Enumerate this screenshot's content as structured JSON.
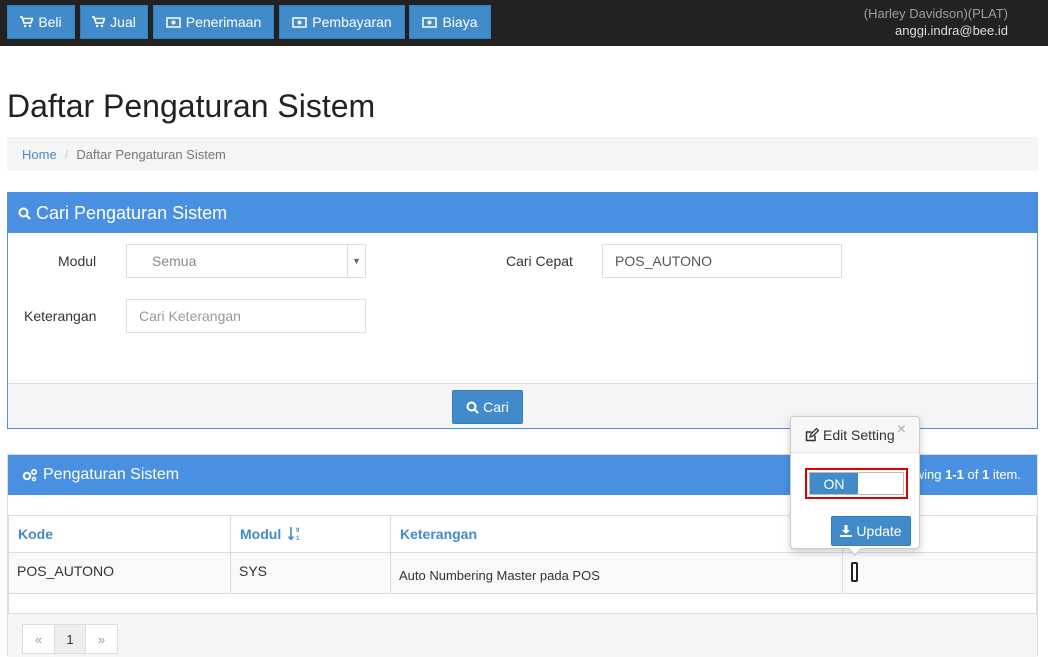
{
  "navbar": {
    "buttons": [
      {
        "label": "Beli",
        "icon": "cart-icon"
      },
      {
        "label": "Jual",
        "icon": "cart-icon"
      },
      {
        "label": "Penerimaan",
        "icon": "money-icon"
      },
      {
        "label": "Pembayaran",
        "icon": "money-icon"
      },
      {
        "label": "Biaya",
        "icon": "money-icon"
      }
    ],
    "company": "(Harley Davidson)(PLAT)",
    "email": "anggi.indra@bee.id"
  },
  "page": {
    "title": "Daftar Pengaturan Sistem",
    "breadcrumb": {
      "home": "Home",
      "separator": "/",
      "current": "Daftar Pengaturan Sistem"
    }
  },
  "search": {
    "heading": "Cari Pengaturan Sistem",
    "modul_label": "Modul",
    "modul_value": "Semua",
    "cari_cepat_label": "Cari Cepat",
    "cari_cepat_value": "POS_AUTONO",
    "keterangan_label": "Keterangan",
    "keterangan_placeholder": "Cari Keterangan",
    "submit_label": "Cari"
  },
  "results": {
    "heading": "Pengaturan Sistem",
    "summary_prefix": "wing ",
    "summary_range": "1-1",
    "summary_of": " of ",
    "summary_total": "1",
    "summary_suffix": " item.",
    "columns": [
      "Kode",
      "Modul",
      "Keterangan"
    ],
    "rows": [
      {
        "kode": "POS_AUTONO",
        "modul": "SYS",
        "keterangan": "Auto Numbering Master pada POS"
      }
    ],
    "pager": {
      "prev": "«",
      "page": "1",
      "next": "»"
    }
  },
  "popover": {
    "title": "Edit Setting",
    "close": "×",
    "toggle_state": "ON",
    "update_label": "Update"
  },
  "colors": {
    "primary": "#428bca",
    "panel_heading": "#4a90e2",
    "highlight": "#e00000"
  }
}
